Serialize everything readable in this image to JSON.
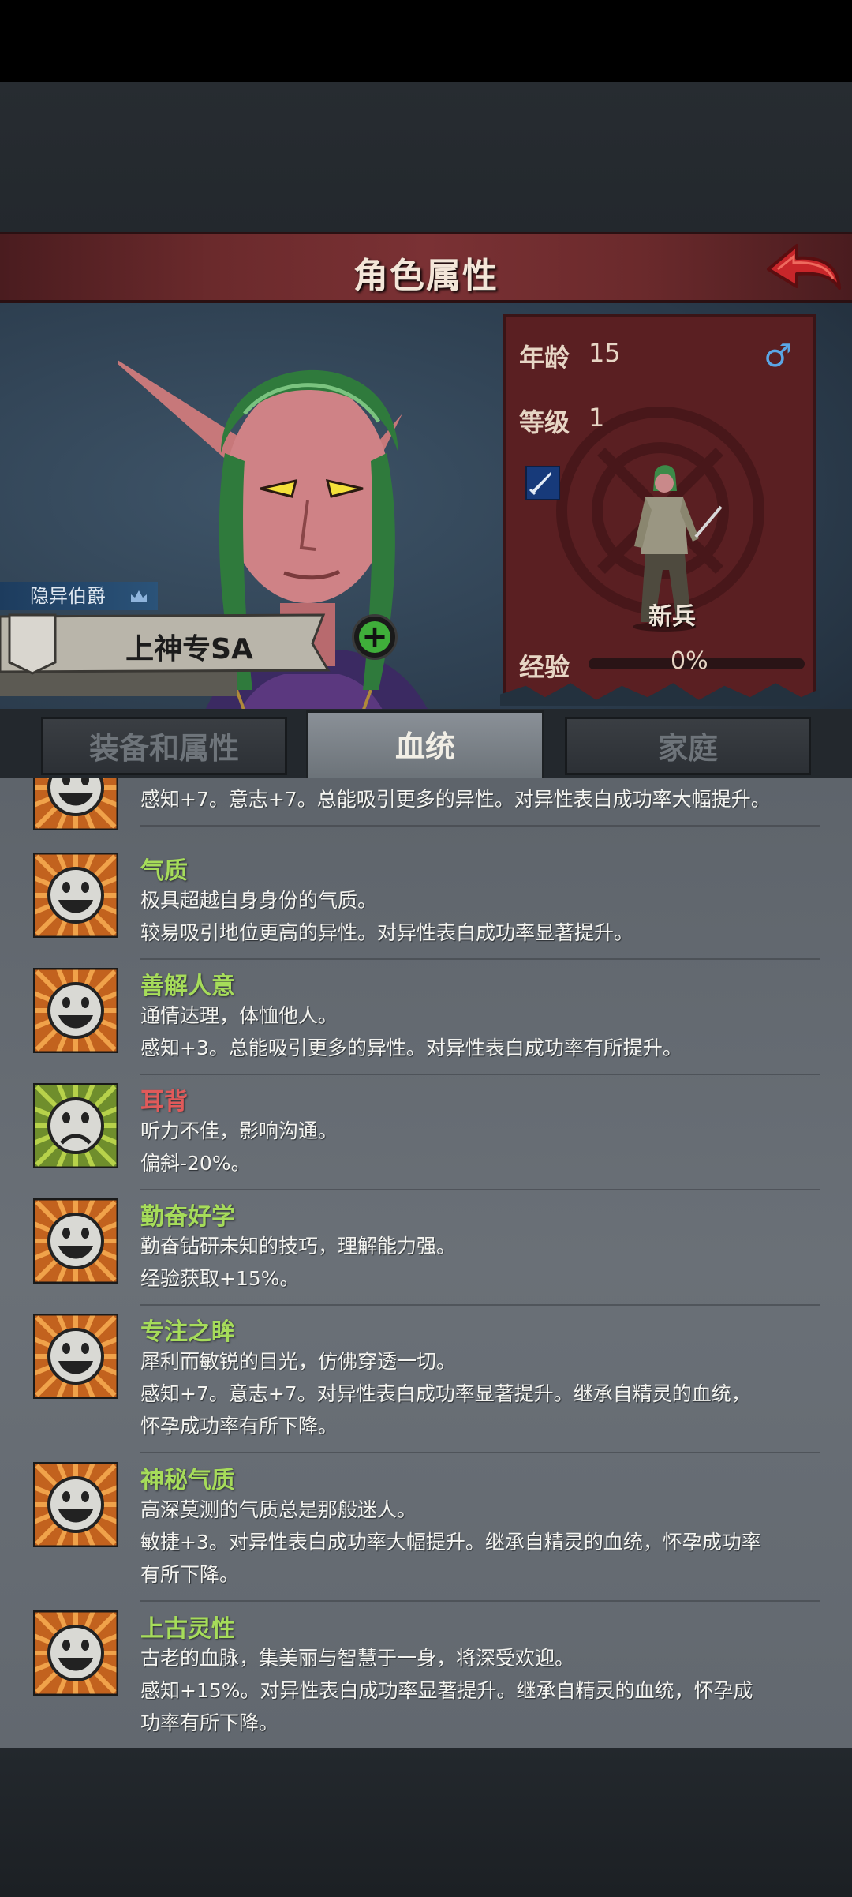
{
  "header": {
    "title": "角色属性"
  },
  "character": {
    "title_label": "隐异伯爵",
    "name": "上神专SA",
    "age_label": "年龄",
    "age": "15",
    "gender_symbol": "♂",
    "level_label": "等级",
    "level": "1",
    "unit_name": "新兵",
    "exp_label": "经验",
    "exp_value": "0%",
    "exp_progress": 0
  },
  "tabs": [
    {
      "label": "装备和属性",
      "active": false
    },
    {
      "label": "血统",
      "active": true
    },
    {
      "label": "家庭",
      "active": false
    }
  ],
  "traits": [
    {
      "name": "",
      "lines": [
        "感知+7。意志+7。总能吸引更多的异性。对异性表白成功率大幅提升。"
      ],
      "mood": "partial"
    },
    {
      "name": "气质",
      "lines": [
        "极具超越自身身份的气质。",
        "较易吸引地位更高的异性。对异性表白成功率显著提升。"
      ],
      "mood": "happy"
    },
    {
      "name": "善解人意",
      "lines": [
        "通情达理，体恤他人。",
        "感知+3。总能吸引更多的异性。对异性表白成功率有所提升。"
      ],
      "mood": "happy"
    },
    {
      "name": "耳背",
      "lines": [
        "听力不佳，影响沟通。",
        "偏斜-20%。"
      ],
      "mood": "sad"
    },
    {
      "name": "勤奋好学",
      "lines": [
        "勤奋钻研未知的技巧，理解能力强。",
        "经验获取+15%。"
      ],
      "mood": "happy"
    },
    {
      "name": "专注之眸",
      "lines": [
        "犀利而敏锐的目光，仿佛穿透一切。",
        "感知+7。意志+7。对异性表白成功率显著提升。继承自精灵的血统，",
        "怀孕成功率有所下降。"
      ],
      "mood": "happy"
    },
    {
      "name": "神秘气质",
      "lines": [
        "高深莫测的气质总是那般迷人。",
        "敏捷+3。对异性表白成功率大幅提升。继承自精灵的血统，怀孕成功率",
        "有所下降。"
      ],
      "mood": "happy"
    },
    {
      "name": "上古灵性",
      "lines": [
        "古老的血脉，集美丽与智慧于一身，将深受欢迎。",
        "感知+15%。对异性表白成功率显著提升。继承自精灵的血统，怀孕成",
        "功率有所下降。"
      ],
      "mood": "happy"
    }
  ],
  "colors": {
    "trait_positive": "#a6dc5a",
    "trait_negative": "#e05a5a",
    "title_bar": "#6b2a2c"
  }
}
